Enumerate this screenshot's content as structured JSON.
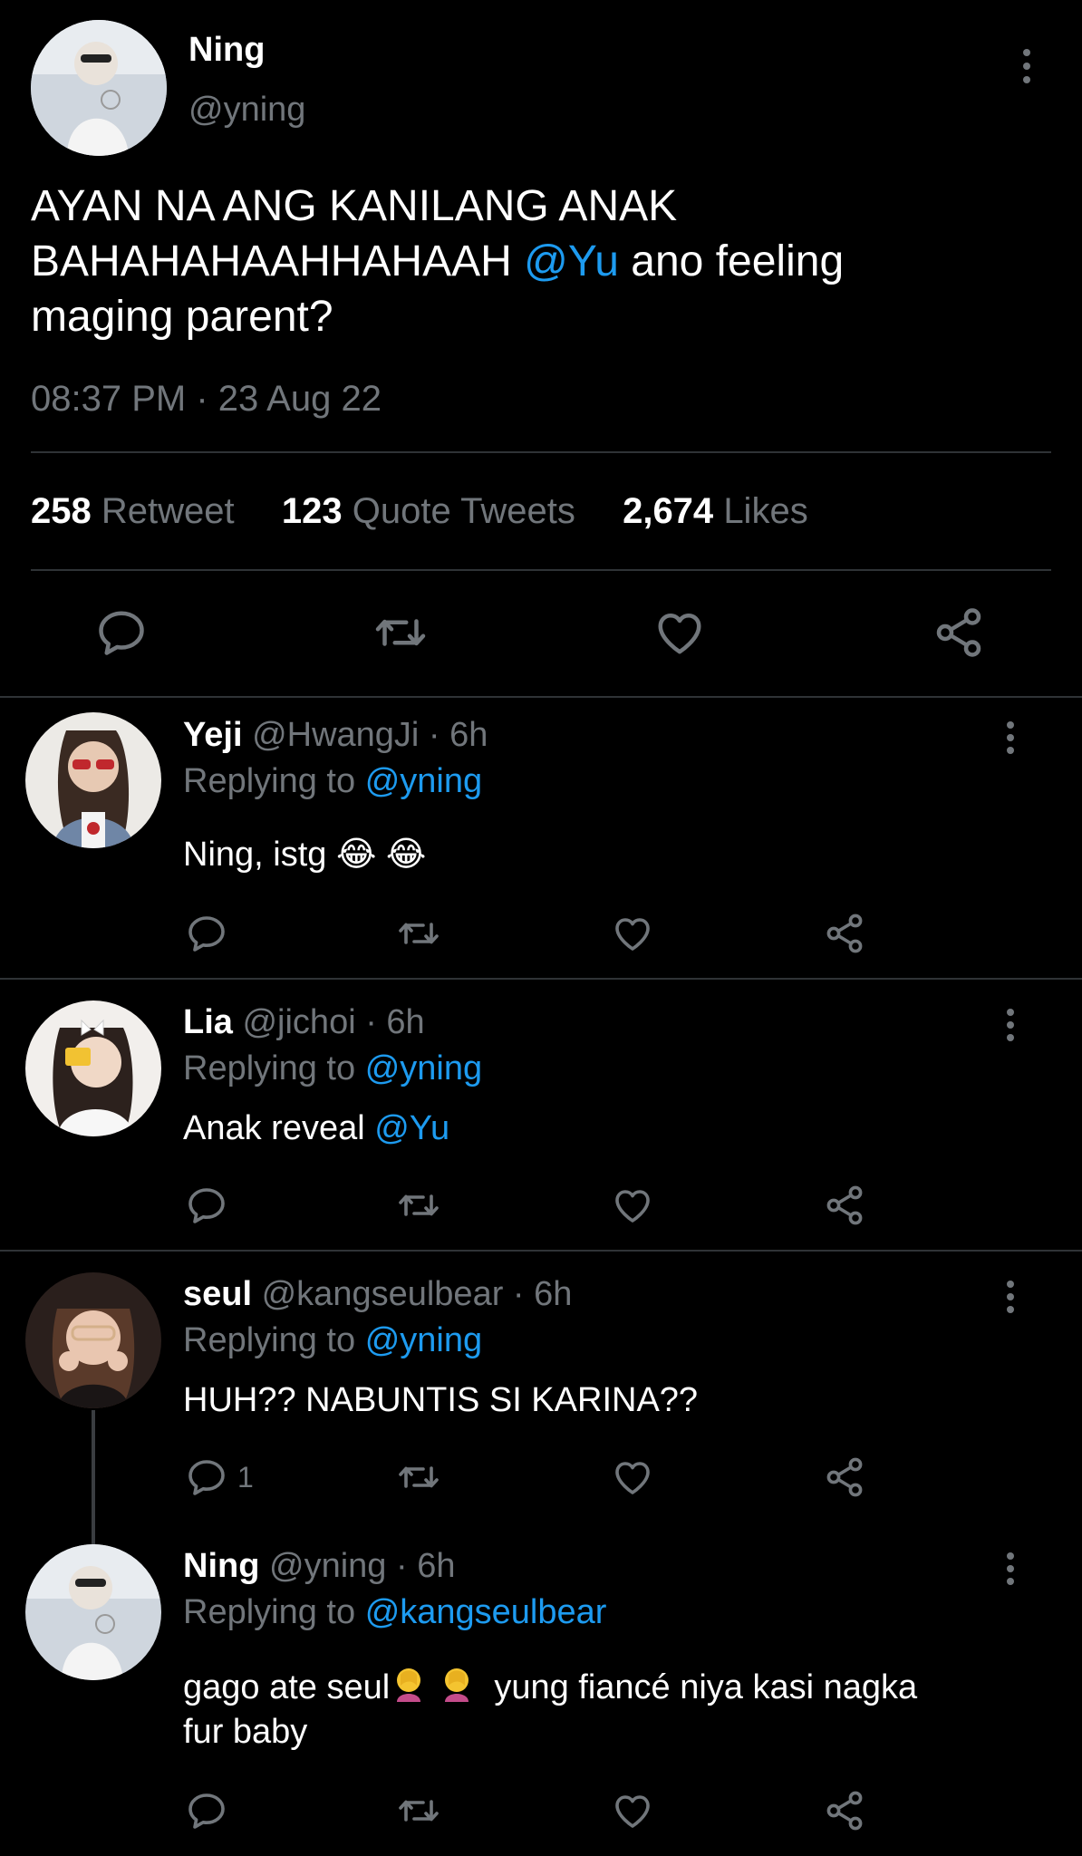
{
  "main_tweet": {
    "name": "Ning",
    "handle": "@yning",
    "text_line1": "AYAN NA ANG KANILANG ANAK",
    "text_line2_a": "BAHAHAHAAHHAHAAH",
    "text_line2_mention": "@Yu",
    "text_line2_b": "ano feeling",
    "text_line3": "maging parent?",
    "timestamp": "08:37 PM · 23 Aug 22",
    "stats": {
      "retweets_count": "258",
      "retweets_label": "Retweet",
      "quotes_count": "123",
      "quotes_label": "Quote Tweets",
      "likes_count": "2,674",
      "likes_label": "Likes"
    }
  },
  "replies": [
    {
      "name": "Yeji",
      "meta": "@HwangJi · 6h",
      "replying_prefix": "Replying to",
      "replying_to": "@yning",
      "text": "Ning, istg",
      "emoji": "😂 😂"
    },
    {
      "name": "Lia",
      "meta": "@jichoi · 6h",
      "replying_prefix": "Replying to",
      "replying_to": "@yning",
      "text": "Anak reveal",
      "mention": "@Yu"
    },
    {
      "name": "seul",
      "meta": "@kangseulbear · 6h",
      "replying_prefix": "Replying to",
      "replying_to": "@yning",
      "text": "HUH?? NABUNTIS SI KARINA??",
      "reply_count": "1"
    },
    {
      "name": "Ning",
      "meta": "@yning · 6h",
      "replying_prefix": "Replying to",
      "replying_to": "@kangseulbear",
      "text_line1_a": "gago ate seul",
      "text_line1_b": "yung fiancé niya kasi nagka",
      "text_line2": "fur baby"
    }
  ],
  "icons": {
    "reply": "reply-icon",
    "retweet": "retweet-icon",
    "like": "heart-icon",
    "share": "share-icon",
    "more": "more-options-icon"
  },
  "colors": {
    "background": "#000000",
    "link": "#1d9bf0",
    "muted": "#71767b",
    "divider": "#2f3336"
  }
}
